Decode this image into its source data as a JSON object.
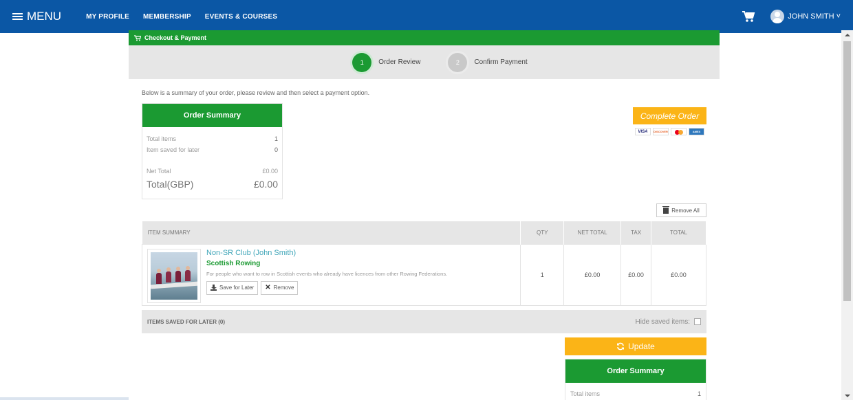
{
  "nav": {
    "menu_label": "MENU",
    "links": [
      "MY PROFILE",
      "MEMBERSHIP",
      "EVENTS & COURSES"
    ],
    "user_name": "JOHN SMITH ˅"
  },
  "panel": {
    "header_title": "Checkout & Payment",
    "steps": [
      {
        "number": "1",
        "label": "Order Review"
      },
      {
        "number": "2",
        "label": "Confirm Payment"
      }
    ],
    "intro": "Below is a summary of your order, please review and then select a payment option."
  },
  "order_summary": {
    "title": "Order Summary",
    "total_items_label": "Total items",
    "total_items": "1",
    "saved_label": "Item saved for later",
    "saved": "0",
    "net_total_label": "Net Total",
    "net_total": "£0.00",
    "total_label": "Total(GBP)",
    "total": "£0.00"
  },
  "payment": {
    "complete_label": "Complete Order",
    "cards": [
      "VISA",
      "DISCOVER",
      "MASTERCARD",
      "AMERICAN EXPRESS"
    ]
  },
  "remove_all_label": "Remove All",
  "table": {
    "headers": [
      "ITEM SUMMARY",
      "QTY",
      "NET TOTAL",
      "TAX",
      "TOTAL"
    ],
    "rows": [
      {
        "title": "Non-SR Club (John Smith)",
        "org": "Scottish Rowing",
        "description": "For people who want to row in Scottish events who already have licences from other Rowing Federations.",
        "qty": "1",
        "net_total": "£0.00",
        "tax": "£0.00",
        "total": "£0.00",
        "save_label": "Save for Later",
        "remove_label": "Remove"
      }
    ]
  },
  "saved_bar": {
    "label": "ITEMS SAVED FOR LATER (0)",
    "hide_label": "Hide saved items:"
  },
  "update_label": "Update",
  "order_summary_bottom": {
    "title": "Order Summary",
    "total_items_label": "Total items",
    "total_items": "1"
  },
  "colors": {
    "nav_blue": "#0b57a5",
    "green": "#1b9a32",
    "orange": "#fbb417",
    "link_teal": "#41a6b9"
  }
}
